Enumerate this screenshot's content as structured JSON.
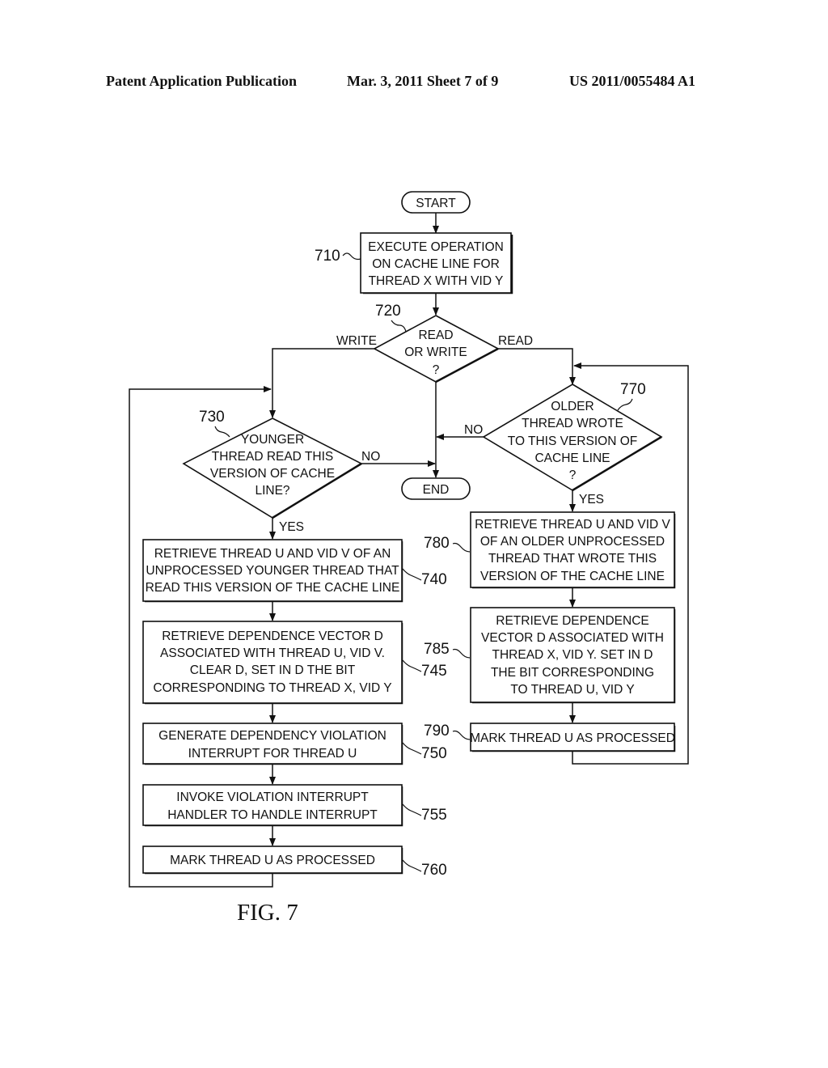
{
  "header": {
    "publication": "Patent Application Publication",
    "date_sheet": "Mar. 3, 2011   Sheet 7 of 9",
    "number": "US 2011/0055484 A1"
  },
  "figure_label": "FIG. 7",
  "nodes": {
    "start": {
      "text": "START"
    },
    "end": {
      "text": "END"
    },
    "n710": {
      "ref": "710",
      "lines": [
        "EXECUTE OPERATION",
        "ON CACHE LINE FOR",
        "THREAD X WITH VID Y"
      ]
    },
    "n720": {
      "ref": "720",
      "lines": [
        "READ",
        "OR WRITE",
        "?"
      ]
    },
    "n730": {
      "ref": "730",
      "lines": [
        "YOUNGER",
        "THREAD READ THIS",
        "VERSION OF CACHE",
        "LINE?"
      ]
    },
    "n740": {
      "ref": "740",
      "lines": [
        "RETRIEVE THREAD U AND VID V OF AN",
        "UNPROCESSED YOUNGER THREAD THAT",
        "READ THIS VERSION OF THE CACHE LINE"
      ]
    },
    "n745": {
      "ref": "745",
      "lines": [
        "RETRIEVE DEPENDENCE VECTOR D",
        "ASSOCIATED WITH THREAD U, VID V.",
        "CLEAR D, SET IN D THE BIT",
        "CORRESPONDING TO THREAD X, VID Y"
      ]
    },
    "n750": {
      "ref": "750",
      "lines": [
        "GENERATE DEPENDENCY VIOLATION",
        "INTERRUPT FOR THREAD U"
      ]
    },
    "n755": {
      "ref": "755",
      "lines": [
        "INVOKE VIOLATION INTERRUPT",
        "HANDLER TO HANDLE INTERRUPT"
      ]
    },
    "n760": {
      "ref": "760",
      "lines": [
        "MARK THREAD U AS PROCESSED"
      ]
    },
    "n770": {
      "ref": "770",
      "lines": [
        "OLDER",
        "THREAD WROTE",
        "TO THIS VERSION OF",
        "CACHE LINE",
        "?"
      ]
    },
    "n780": {
      "ref": "780",
      "lines": [
        "RETRIEVE THREAD U AND VID V",
        "OF AN OLDER UNPROCESSED",
        "THREAD THAT WROTE THIS",
        "VERSION OF THE CACHE LINE"
      ]
    },
    "n785": {
      "ref": "785",
      "lines": [
        "RETRIEVE DEPENDENCE",
        "VECTOR D ASSOCIATED WITH",
        "THREAD X, VID Y. SET IN D",
        "THE BIT CORRESPONDING",
        "TO THREAD U, VID Y"
      ]
    },
    "n790": {
      "ref": "790",
      "lines": [
        "MARK THREAD U AS PROCESSED"
      ]
    }
  },
  "edge_labels": {
    "write": "WRITE",
    "read": "READ",
    "no_730": "NO",
    "yes_730": "YES",
    "no_770": "NO",
    "yes_770": "YES"
  }
}
